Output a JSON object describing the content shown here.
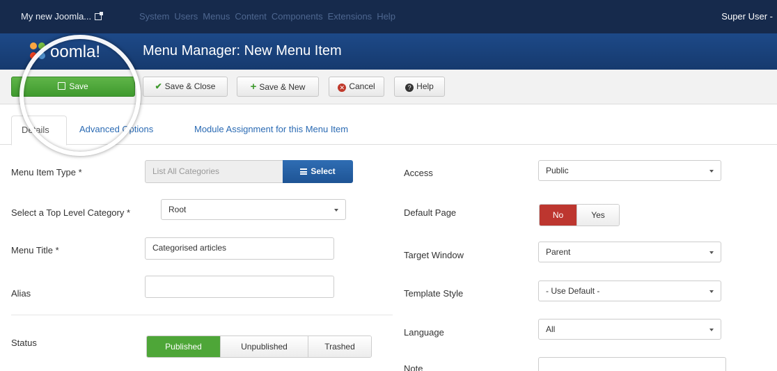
{
  "topnav": {
    "site": "My new Joomla...",
    "menu": [
      "System",
      "Users",
      "Menus",
      "Content",
      "Components",
      "Extensions",
      "Help"
    ],
    "user": "Super User -"
  },
  "header": {
    "title": "Menu Manager: New Menu Item"
  },
  "toolbar": {
    "save": "Save",
    "save_close": "Save & Close",
    "save_new": "Save & New",
    "cancel": "Cancel",
    "help": "Help"
  },
  "tabs": [
    "Details",
    "Advanced Options",
    "Module Assignment for this Menu Item"
  ],
  "form": {
    "menu_item_type_label": "Menu Item Type *",
    "menu_item_type_value": "List All Categories",
    "select_button": "Select",
    "top_level_label": "Select a Top Level Category *",
    "top_level_value": "Root",
    "menu_title_label": "Menu Title *",
    "menu_title_value": "Categorised articles",
    "alias_label": "Alias",
    "alias_value": "",
    "status_label": "Status",
    "status_options": [
      "Published",
      "Unpublished",
      "Trashed"
    ],
    "status_selected": "Published",
    "access_label": "Access",
    "access_value": "Public",
    "default_page_label": "Default Page",
    "default_page_options": [
      "No",
      "Yes"
    ],
    "default_page_selected": "No",
    "target_window_label": "Target Window",
    "target_window_value": "Parent",
    "template_style_label": "Template Style",
    "template_style_value": "- Use Default -",
    "language_label": "Language",
    "language_value": "All",
    "note_label": "Note",
    "note_value": ""
  },
  "colors": {
    "topnav_bg": "#162a4c",
    "header_bg": "#1d4988",
    "save_green": "#4ea638",
    "select_blue": "#2f6db3",
    "no_red": "#bd362f",
    "link_blue": "#2a6ab3"
  }
}
